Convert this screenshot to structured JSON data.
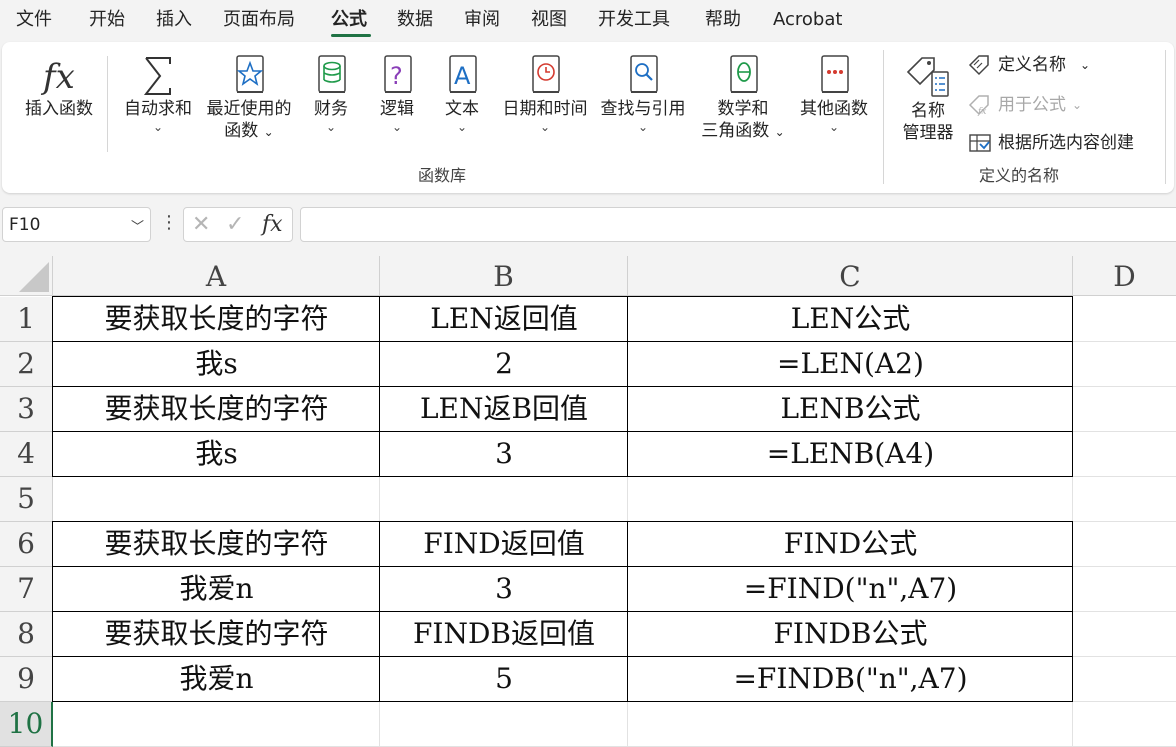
{
  "menu": {
    "tabs": [
      "文件",
      "开始",
      "插入",
      "页面布局",
      "公式",
      "数据",
      "审阅",
      "视图",
      "开发工具",
      "帮助",
      "Acrobat"
    ],
    "active": "公式"
  },
  "ribbon": {
    "insert_function": "插入函数",
    "autosum": "自动求和",
    "recent_1": "最近使用的",
    "recent_2": "函数",
    "financial": "财务",
    "logical": "逻辑",
    "text": "文本",
    "datetime": "日期和时间",
    "lookup": "查找与引用",
    "math_1": "数学和",
    "math_2": "三角函数",
    "other": "其他函数",
    "group_library": "函数库",
    "name_manager_1": "名称",
    "name_manager_2": "管理器",
    "define_name": "定义名称",
    "use_in_formula": "用于公式",
    "create_from_selection": "根据所选内容创建",
    "group_defined_names": "定义的名称"
  },
  "formula_bar": {
    "name_box": "F10",
    "formula": ""
  },
  "sheet": {
    "columns": [
      "A",
      "B",
      "C",
      "D"
    ],
    "rows": [
      "1",
      "2",
      "3",
      "4",
      "5",
      "6",
      "7",
      "8",
      "9",
      "10"
    ],
    "selected_row": "10",
    "cells": [
      [
        "要获取长度的字符",
        "LEN返回值",
        "LEN公式"
      ],
      [
        "我s",
        "2",
        "=LEN(A2)"
      ],
      [
        "要获取长度的字符",
        "LEN返B回值",
        "LENB公式"
      ],
      [
        "我s",
        "3",
        "=LENB(A4)"
      ],
      [
        "",
        "",
        ""
      ],
      [
        "要获取长度的字符",
        "FIND返回值",
        "FIND公式"
      ],
      [
        "我爱n",
        "3",
        "=FIND(\"n\",A7)"
      ],
      [
        "要获取长度的字符",
        "FINDB返回值",
        "FINDB公式"
      ],
      [
        "我爱n",
        "5",
        "=FINDB(\"n\",A7)"
      ],
      [
        "",
        "",
        ""
      ]
    ]
  },
  "colors": {
    "accent": "#1f7244",
    "ribbon_bg": "#ffffff",
    "app_bg": "#f3f3f3"
  }
}
